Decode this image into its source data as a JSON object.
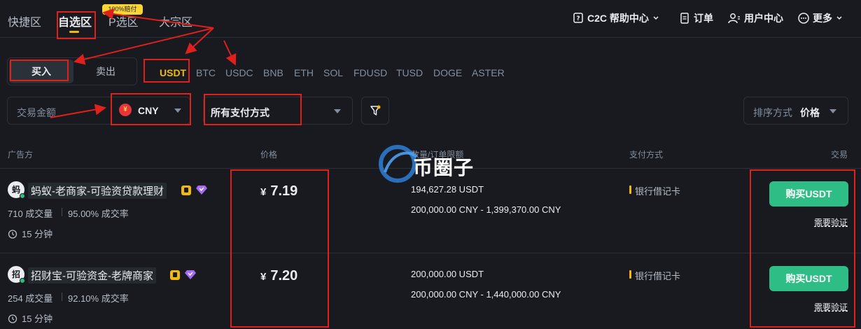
{
  "topnav": {
    "tabs": [
      "快捷区",
      "自选区",
      "P选区",
      "大宗区"
    ],
    "promo_badge": "100%赔付",
    "help_center": "C2C 帮助中心",
    "orders": "订单",
    "user_center": "用户中心",
    "more": "更多"
  },
  "trade_side": {
    "buy": "买入",
    "sell": "卖出"
  },
  "coins": [
    "USDT",
    "BTC",
    "USDC",
    "BNB",
    "ETH",
    "SOL",
    "FDUSD",
    "TUSD",
    "DOGE",
    "ASTER"
  ],
  "filters": {
    "amount_placeholder": "交易金额",
    "fiat": "CNY",
    "fiat_flag": "¥",
    "payment": "所有支付方式",
    "sort_label": "排序方式",
    "sort_value": "价格"
  },
  "table": {
    "headers": {
      "advertiser": "广告方",
      "price": "价格",
      "limits": "数量/订单限额",
      "payment": "支付方式",
      "trade": "交易"
    },
    "rows": [
      {
        "avatar": "蚂",
        "name": "蚂蚁-老商家-可验资贷款理财",
        "orders": "710 成交量",
        "completion": "95.00% 成交率",
        "time": "15 分钟",
        "currency_symbol": "¥",
        "price": "7.19",
        "available": "194,627.28 USDT",
        "limit": "200,000.00 CNY - 1,399,370.00 CNY",
        "payment": "银行借记卡",
        "button": "购买USDT",
        "verify": "需要验证"
      },
      {
        "avatar": "招",
        "name": "招财宝-可验资金-老牌商家",
        "orders": "254 成交量",
        "completion": "92.10% 成交率",
        "time": "15 分钟",
        "currency_symbol": "¥",
        "price": "7.20",
        "available": "200,000.00 USDT",
        "limit": "200,000.00 CNY - 1,440,000.00 CNY",
        "payment": "银行借记卡",
        "button": "购买USDT",
        "verify": "需要验证"
      }
    ]
  },
  "watermark": "币圈子",
  "colors": {
    "background": "#181a20",
    "accent": "#f0b90b",
    "buy_green": "#2ebd85",
    "annotation_red": "#e0201b"
  }
}
